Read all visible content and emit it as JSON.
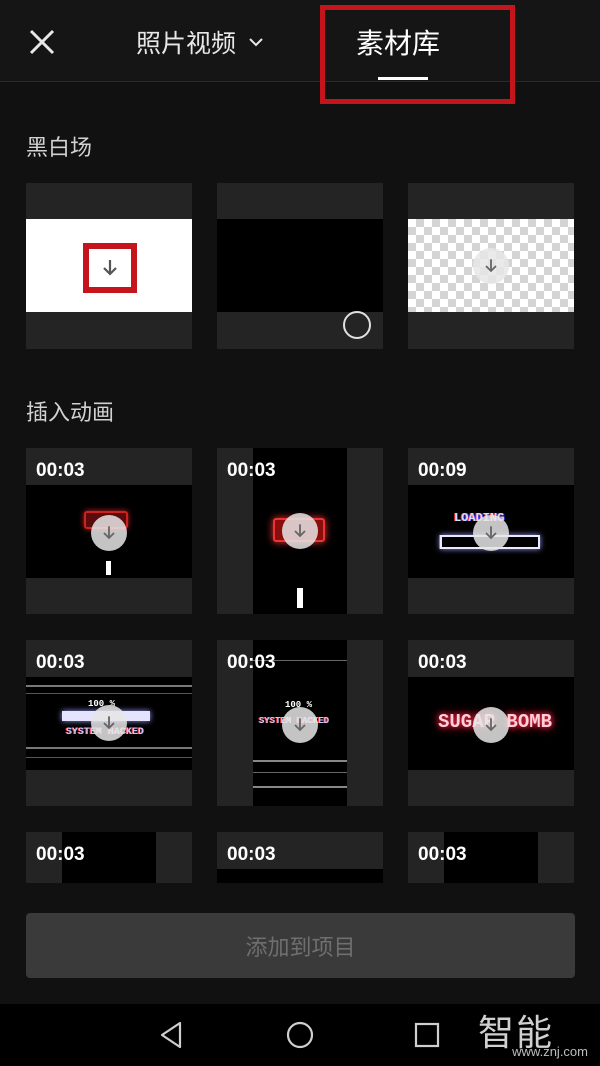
{
  "header": {
    "close_icon": "close-icon",
    "source_tab_label": "照片视频",
    "library_tab_label": "素材库",
    "highlight_color": "#c4141c"
  },
  "sections": {
    "black_white": {
      "title": "黑白场"
    },
    "intro_anim": {
      "title": "插入动画"
    }
  },
  "tiles": {
    "t1": {
      "duration": "00:03"
    },
    "t2": {
      "duration": "00:03"
    },
    "t3": {
      "duration": "00:09",
      "overlay_text": "LOADING"
    },
    "t4": {
      "duration": "00:03",
      "overlay_text": "SYSTEM HACKED",
      "overlay_pct": "100 %"
    },
    "t5": {
      "duration": "00:03",
      "overlay_text": "SYSTEM HACKED",
      "overlay_pct": "100 %"
    },
    "t6": {
      "duration": "00:03",
      "overlay_text": "SUGAR BOMB"
    },
    "t7": {
      "duration": "00:03"
    },
    "t8": {
      "duration": "00:03"
    },
    "t9": {
      "duration": "00:03"
    }
  },
  "footer": {
    "add_button_label": "添加到项目"
  },
  "watermark": {
    "text": "智能家",
    "url": "www.znj.com"
  }
}
